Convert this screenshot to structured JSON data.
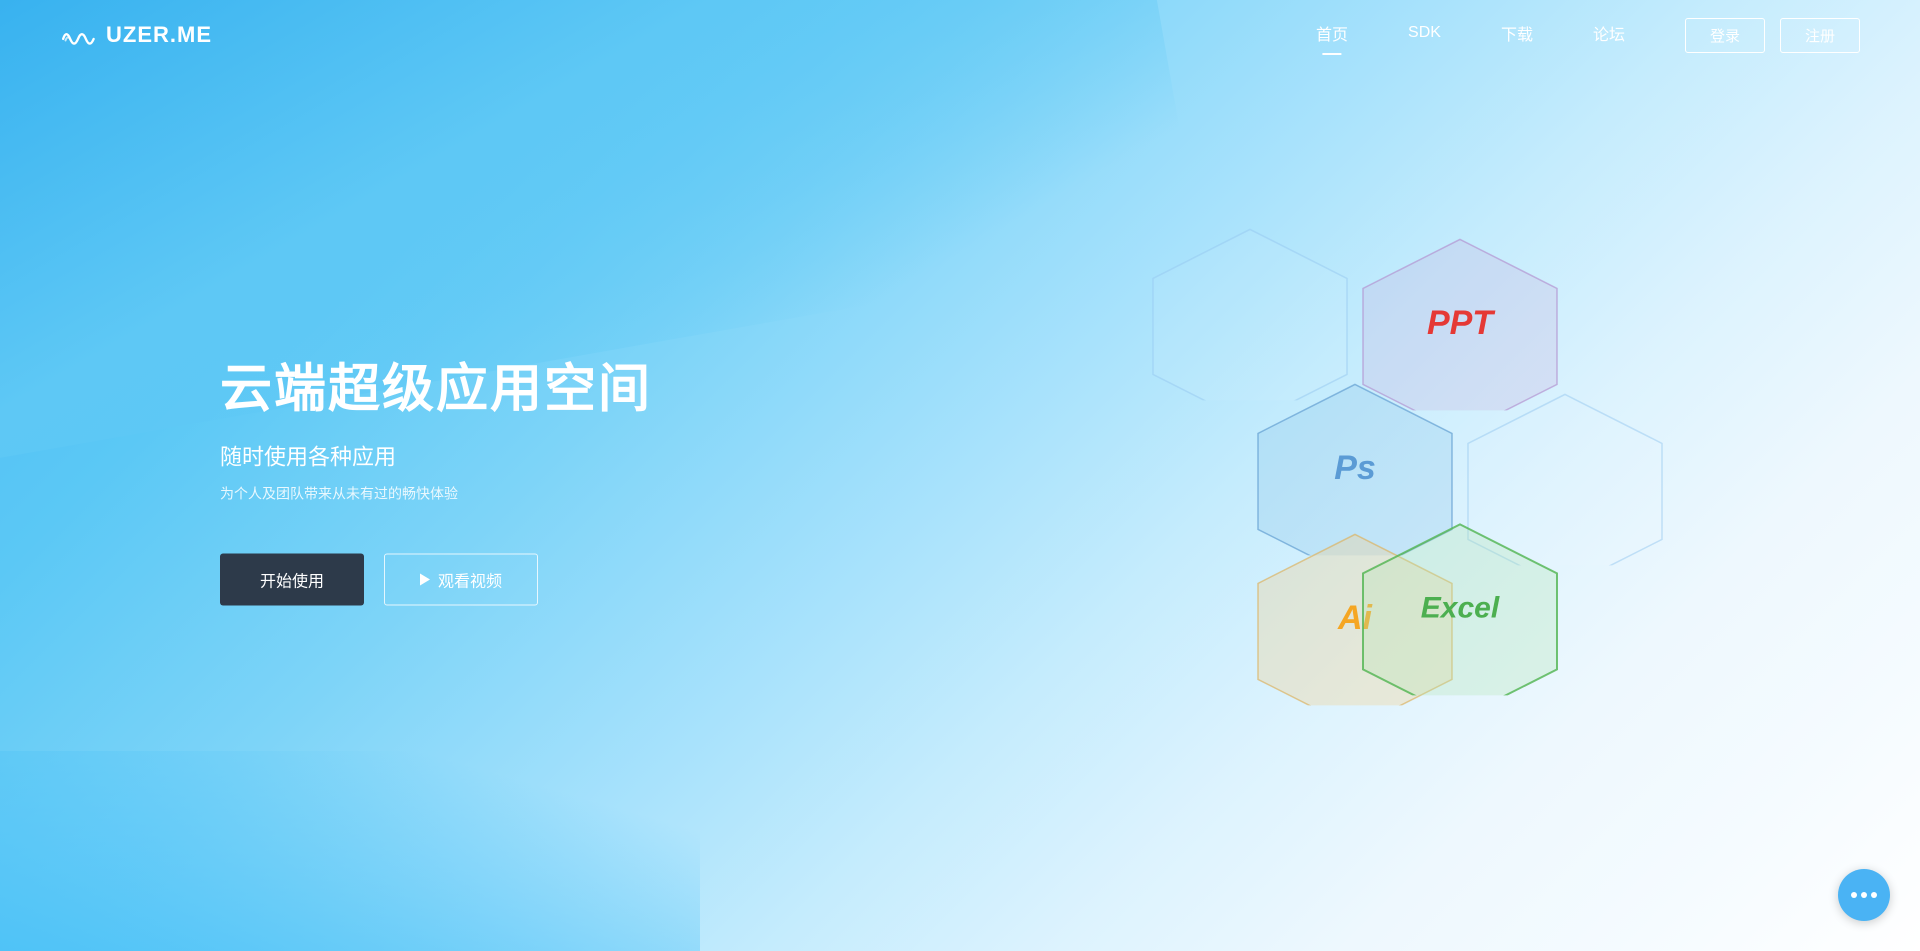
{
  "brand": {
    "name": "UZER.ME"
  },
  "navbar": {
    "links": [
      {
        "label": "首页",
        "active": true
      },
      {
        "label": "SDK",
        "active": false
      },
      {
        "label": "下载",
        "active": false
      },
      {
        "label": "论坛",
        "active": false
      }
    ],
    "login_label": "登录",
    "register_label": "注册"
  },
  "hero": {
    "title": "云端超级应用空间",
    "subtitle": "随时使用各种应用",
    "description": "为个人及团队带来从未有过的畅快体验",
    "btn_start": "开始使用",
    "btn_watch": "观看视频"
  },
  "hexagons": [
    {
      "id": "ppt",
      "label": "PPT",
      "color": "#e53935"
    },
    {
      "id": "ps",
      "label": "Ps",
      "color": "#5b9bd5"
    },
    {
      "id": "ai",
      "label": "Ai",
      "color": "#f5a623"
    },
    {
      "id": "excel",
      "label": "Excel",
      "color": "#4caf50"
    }
  ],
  "chat": {
    "dots": 3
  }
}
